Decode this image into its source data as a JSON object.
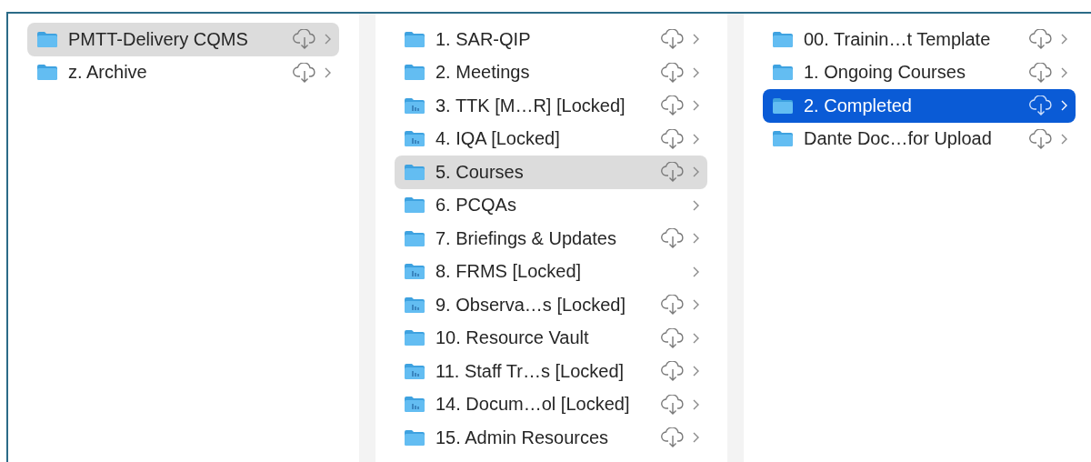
{
  "columns": [
    {
      "active": false,
      "items": [
        {
          "name": "PMTT-Delivery CQMS",
          "kind": "plain",
          "cloud": true,
          "selected": true
        },
        {
          "name": "z. Archive",
          "kind": "plain",
          "cloud": true,
          "selected": false
        }
      ]
    },
    {
      "active": false,
      "items": [
        {
          "name": "1. SAR-QIP",
          "kind": "plain",
          "cloud": true,
          "selected": false
        },
        {
          "name": "2. Meetings",
          "kind": "plain",
          "cloud": true,
          "selected": false
        },
        {
          "name": "3. TTK [M…R] [Locked]",
          "kind": "shared",
          "cloud": true,
          "selected": false
        },
        {
          "name": "4. IQA [Locked]",
          "kind": "shared",
          "cloud": true,
          "selected": false
        },
        {
          "name": "5. Courses",
          "kind": "plain",
          "cloud": true,
          "selected": true
        },
        {
          "name": "6. PCQAs",
          "kind": "plain",
          "cloud": false,
          "selected": false
        },
        {
          "name": "7. Briefings & Updates",
          "kind": "plain",
          "cloud": true,
          "selected": false
        },
        {
          "name": "8. FRMS [Locked]",
          "kind": "shared",
          "cloud": false,
          "selected": false
        },
        {
          "name": "9. Observa…s [Locked]",
          "kind": "shared",
          "cloud": true,
          "selected": false
        },
        {
          "name": "10. Resource Vault",
          "kind": "plain",
          "cloud": true,
          "selected": false
        },
        {
          "name": "11. Staff Tr…s [Locked]",
          "kind": "shared",
          "cloud": true,
          "selected": false
        },
        {
          "name": "14. Docum…ol [Locked]",
          "kind": "shared",
          "cloud": true,
          "selected": false
        },
        {
          "name": "15. Admin Resources",
          "kind": "plain",
          "cloud": true,
          "selected": false
        }
      ]
    },
    {
      "active": true,
      "items": [
        {
          "name": "00. Trainin…t Template",
          "kind": "plain",
          "cloud": true,
          "selected": false
        },
        {
          "name": "1. Ongoing Courses",
          "kind": "plain",
          "cloud": true,
          "selected": false
        },
        {
          "name": "2. Completed",
          "kind": "plain",
          "cloud": true,
          "selected": true
        },
        {
          "name": "Dante Doc…for Upload",
          "kind": "plain",
          "cloud": true,
          "selected": false
        }
      ]
    }
  ]
}
